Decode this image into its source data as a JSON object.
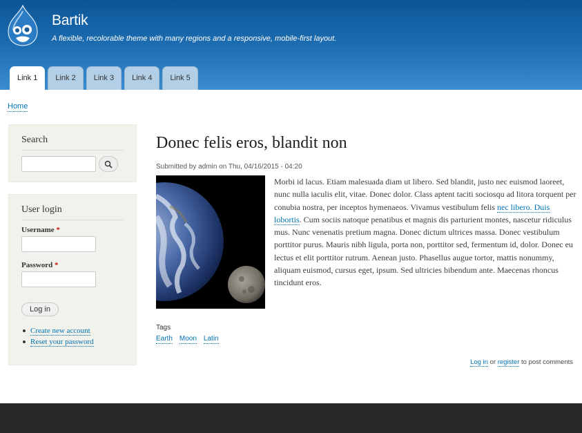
{
  "header": {
    "site_name": "Bartik",
    "slogan": "A flexible, recolorable theme with many regions and a responsive, mobile-first layout.",
    "logo_icon": "drupal-drop-icon",
    "tabs": [
      {
        "label": "Link 1",
        "active": true
      },
      {
        "label": "Link 2",
        "active": false
      },
      {
        "label": "Link 3",
        "active": false
      },
      {
        "label": "Link 4",
        "active": false
      },
      {
        "label": "Link 5",
        "active": false
      }
    ]
  },
  "breadcrumb": {
    "home": "Home"
  },
  "sidebar": {
    "search": {
      "title": "Search",
      "button_icon": "search-icon"
    },
    "login": {
      "title": "User login",
      "username_label": "Username",
      "password_label": "Password",
      "required_marker": "*",
      "login_button": "Log in",
      "links": [
        "Create new account",
        "Reset your password"
      ]
    }
  },
  "node": {
    "title": "Donec felis eros, blandit non",
    "submitted": "Submitted by admin on Thu, 04/16/2015 - 04:20",
    "image": "earth-and-moon-image",
    "body_before_link": "Morbi id lacus. Etiam malesuada diam ut libero. Sed blandit, justo nec euismod laoreet, nunc nulla iaculis elit, vitae. Donec dolor. Class aptent taciti sociosqu ad litora torquent per conubia nostra, per inceptos hymenaeos. Vivamus vestibulum felis ",
    "body_link": "nec libero. Duis lobortis",
    "body_after_link": ". Cum sociis natoque penatibus et magnis dis parturient montes, nascetur ridiculus mus. Nunc venenatis pretium magna. Donec dictum ultrices massa. Donec vestibulum porttitor purus. Mauris nibh ligula, porta non, porttitor sed, fermentum id, dolor. Donec eu lectus et elit porttitor rutrum. Aenean justo. Phasellus augue tortor, mattis nonummy, aliquam euismod, cursus eget, ipsum. Sed ultricies bibendum ante. Maecenas rhoncus tincidunt eros.",
    "tags_label": "Tags",
    "tags": [
      "Earth",
      "Moon",
      "Latin"
    ],
    "comments": {
      "login_link": "Log in",
      "or_text": " or ",
      "register_link": "register",
      "suffix": " to post comments"
    }
  },
  "colors": {
    "header_dark": "#0a5597",
    "header_light": "#3a8bd0",
    "link": "#0071b3",
    "sidebar_bg": "#f2f2ec",
    "footer": "#292929",
    "required": "#c4170c"
  }
}
